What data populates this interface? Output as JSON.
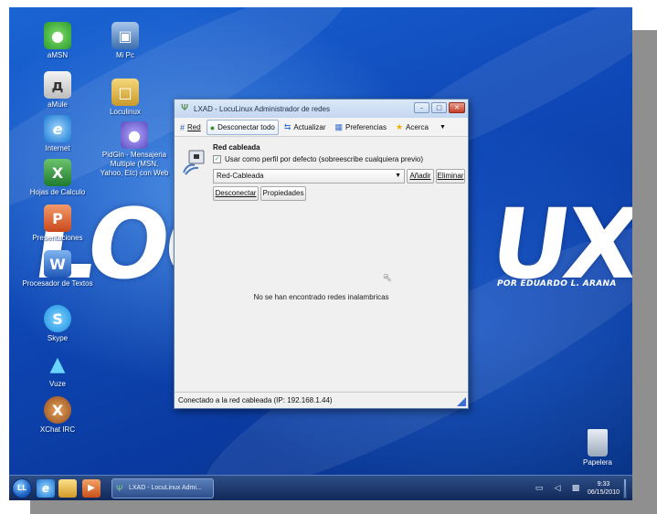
{
  "desktop": {
    "logo": {
      "letters_left": "LOC",
      "letters_right": "UX",
      "subtitle": "POR EDUARDO L. ARANA"
    },
    "icons": [
      {
        "label": "aMSN",
        "icon": "amsn-icon"
      },
      {
        "label": "Mi Pc",
        "icon": "computer-icon"
      },
      {
        "label": "aMule",
        "icon": "amule-icon"
      },
      {
        "label": "Loculinux",
        "icon": "folder-icon"
      },
      {
        "label": "Internet",
        "icon": "internet-explorer-icon"
      },
      {
        "label": "PidGin - Mensajeria Multiple (MSN, Yahoo, Etc) con Web",
        "icon": "pidgin-icon"
      },
      {
        "label": "Hojas de Calculo",
        "icon": "spreadsheet-icon"
      },
      {
        "label": "Presentaciones",
        "icon": "presentation-icon"
      },
      {
        "label": "Procesador de Textos",
        "icon": "word-processor-icon"
      },
      {
        "label": "Skype",
        "icon": "skype-icon"
      },
      {
        "label": "Vuze",
        "icon": "vuze-icon"
      },
      {
        "label": "XChat IRC",
        "icon": "xchat-icon"
      },
      {
        "label": "Papelera",
        "icon": "trash-icon"
      }
    ]
  },
  "window": {
    "title": "LXAD - LocuLinux Administrador de redes",
    "toolbar": {
      "red": "Red",
      "disconnect_all": "Desconectar todo",
      "refresh": "Actualizar",
      "preferences": "Preferencias",
      "about": "Acerca"
    },
    "wired": {
      "title": "Red cableada",
      "default_profile_label": "Usar como perfil por defecto (sobreescribe cualquiera previo)",
      "default_profile_checked": true,
      "profile_selected": "Red-Cableada",
      "add": "Añadir",
      "delete": "Eliminar",
      "disconnect": "Desconectar",
      "properties": "Propiedades"
    },
    "empty_message": "No se han encontrado redes inalambricas",
    "status": "Conectado a la red cableada (IP: 192.168.1.44)"
  },
  "taskbar": {
    "start_label": "LL",
    "task_item": "LXAD - LocuLinux Admi...",
    "clock_time": "9:33",
    "clock_date": "06/15/2010"
  },
  "colors": {
    "desktop_blue": "#1553c2",
    "window_frame": "#5d7fa8",
    "taskbar": "#1e3a70"
  }
}
